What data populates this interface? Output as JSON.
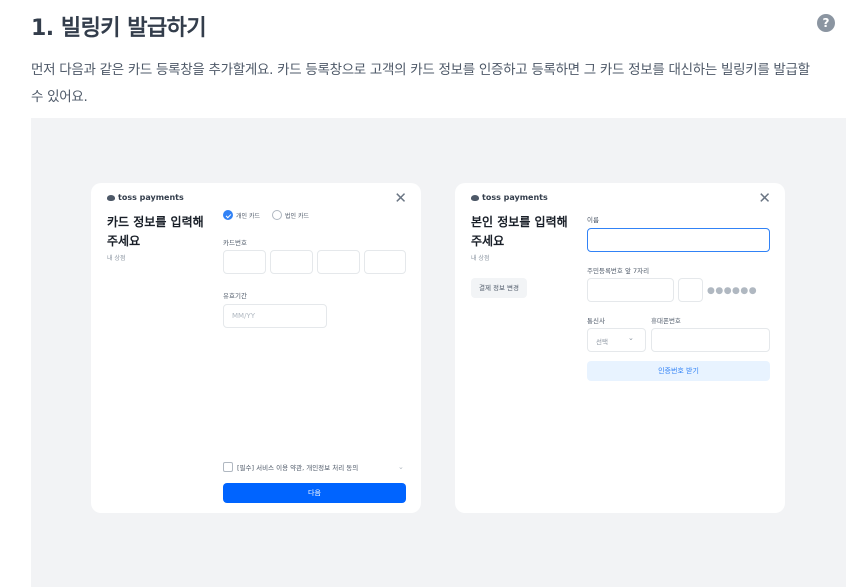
{
  "header": {
    "title": "1. 빌링키 발급하기",
    "help_icon": "question-icon",
    "help_glyph": "?"
  },
  "description": "먼저 다음과 같은 카드 등록창을 추가할게요. 카드 등록창으로 고객의 카드 정보를 인증하고 등록하면 그 카드 정보를 대신하는 빌링키를 발급할 수 있어요.",
  "left_card": {
    "logo": "toss payments",
    "close": "✕",
    "heading": "카드 정보를 입력해주세요",
    "sub": "내 상점",
    "radio_personal": "개인 카드",
    "radio_corporate": "법인 카드",
    "card_number_label": "카드번호",
    "expiry_label": "유효기간",
    "expiry_placeholder": "MM/YY",
    "agree_text": "[필수] 서비스 이용 약관, 개인정보 처리 동의",
    "agree_chevron": "⌄",
    "next_button": "다음"
  },
  "right_card": {
    "logo": "toss payments",
    "close": "✕",
    "heading": "본인 정보를 입력해주세요",
    "sub": "내 상점",
    "change_button": "결제 정보 변경",
    "name_label": "이름",
    "rrn_label": "주민등록번호 앞 7자리",
    "rrn_mask": "●●●●●●",
    "carrier_label": "통신사",
    "carrier_value": "선택",
    "carrier_chevron": "⌄",
    "phone_label": "휴대폰번호",
    "verify_button": "인증번호 받기"
  },
  "colors": {
    "accent": "#3182f6",
    "primary_button": "#0064ff",
    "stage_bg": "#f2f3f5"
  }
}
